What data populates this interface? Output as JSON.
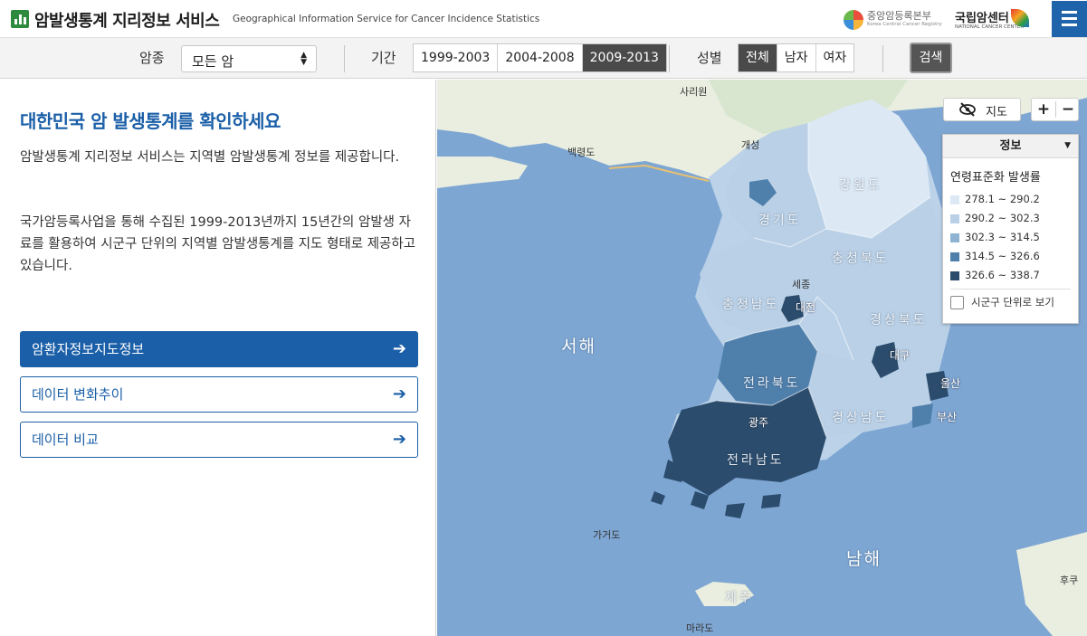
{
  "header": {
    "title": "암발생통계 지리정보 서비스",
    "subtitle": "Geographical Information Service for Cancer Incidence Statistics",
    "partner1_ko": "중앙암등록본부",
    "partner1_en": "Korea Central Cancer Registry",
    "partner2_ko": "국립암센터",
    "partner2_en": "NATIONAL CANCER CENTER",
    "menu_icon": "hamburger-menu-icon",
    "brand_color": "#1f64ab"
  },
  "filters": {
    "cancer_label": "암종",
    "cancer_value": "모든 암",
    "period_label": "기간",
    "periods": [
      "1999-2003",
      "2004-2008",
      "2009-2013"
    ],
    "period_selected": "2009-2013",
    "sex_label": "성별",
    "sexes": [
      "전체",
      "남자",
      "여자"
    ],
    "sex_selected": "전체",
    "search_label": "검색"
  },
  "left_panel": {
    "heading": "대한민국 암 발생통계를 확인하세요",
    "para1": "암발생통계 지리정보 서비스는 지역별 암발생통계 정보를 제공합니다.",
    "para2": "국가암등록사업을 통해 수집된 1999-2013년까지 15년간의 암발생 자료를 활용하여 시군구 단위의 지역별 암발생통계를 지도 형태로 제공하고 있습니다.",
    "buttons": [
      "암환자정보지도정보",
      "데이터 변화추이",
      "데이터 비교"
    ],
    "arrow_icon": "arrow-right-icon"
  },
  "map": {
    "toggle_label": "지도",
    "zoom_in": "+",
    "zoom_out": "−",
    "labels": {
      "sariwon": "사리원",
      "baengnyeongdo": "백령도",
      "kaesong": "개성",
      "gangwon": "강원도",
      "gyeonggi": "경기도",
      "chungbuk": "충청북도",
      "sejong": "세종",
      "chungnam": "충청남도",
      "daejeon": "대전",
      "gyeongbuk": "경상북도",
      "daegu": "대구",
      "ulsan": "울산",
      "jeonbuk": "전라북도",
      "gwangju": "광주",
      "gyeongnam": "경상남도",
      "busan": "부산",
      "jeonnam": "전라남도",
      "gageodo": "가거도",
      "jeju": "제주",
      "marado": "마라도",
      "fukue": "후쿠",
      "west_sea": "서해",
      "south_sea": "남해"
    }
  },
  "legend": {
    "header": "정보",
    "title": "연령표준화 발생률",
    "classes": [
      {
        "range": "278.1 ~ 290.2",
        "color": "#dce9f5"
      },
      {
        "range": "290.2 ~ 302.3",
        "color": "#b9d0e6"
      },
      {
        "range": "302.3 ~ 314.5",
        "color": "#8fb3d3"
      },
      {
        "range": "314.5 ~ 326.6",
        "color": "#4f7fab"
      },
      {
        "range": "326.6 ~ 338.7",
        "color": "#2b4c6c"
      }
    ],
    "checkbox_label": "시군구 단위로 보기"
  }
}
